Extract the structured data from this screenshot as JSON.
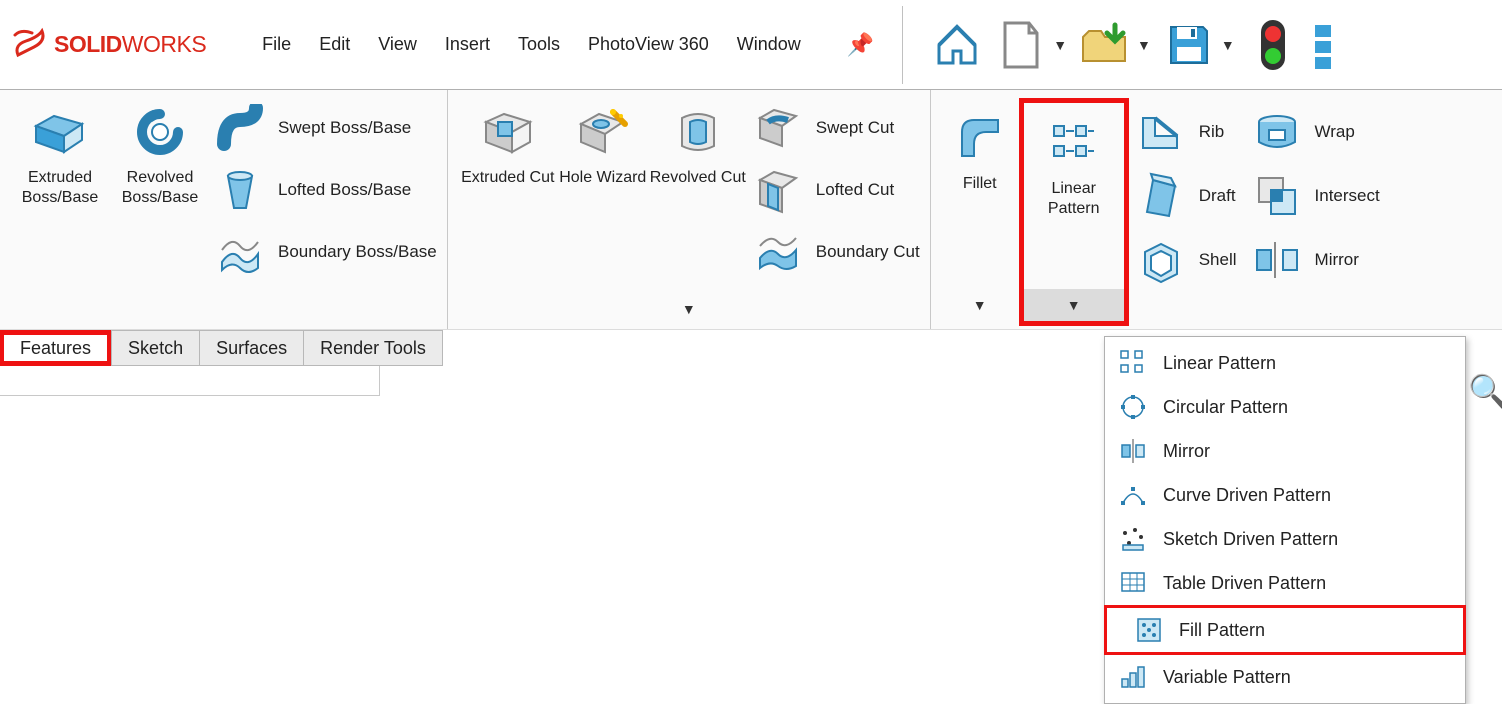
{
  "app": {
    "name_bold": "SOLID",
    "name_thin": "WORKS"
  },
  "menu": {
    "file": "File",
    "edit": "Edit",
    "view": "View",
    "insert": "Insert",
    "tools": "Tools",
    "photoview": "PhotoView 360",
    "window": "Window"
  },
  "ribbon": {
    "extruded_boss": "Extruded Boss/Base",
    "revolved_boss": "Revolved Boss/Base",
    "swept_boss": "Swept Boss/Base",
    "lofted_boss": "Lofted Boss/Base",
    "boundary_boss": "Boundary Boss/Base",
    "extruded_cut": "Extruded Cut",
    "hole_wizard": "Hole Wizard",
    "revolved_cut": "Revolved Cut",
    "swept_cut": "Swept Cut",
    "lofted_cut": "Lofted Cut",
    "boundary_cut": "Boundary Cut",
    "fillet": "Fillet",
    "linear_pattern": "Linear Pattern",
    "rib": "Rib",
    "draft": "Draft",
    "shell": "Shell",
    "wrap": "Wrap",
    "intersect": "Intersect",
    "mirror": "Mirror"
  },
  "tabs": {
    "features": "Features",
    "sketch": "Sketch",
    "surfaces": "Surfaces",
    "render": "Render Tools"
  },
  "dropdown": {
    "linear": "Linear Pattern",
    "circular": "Circular Pattern",
    "mirror": "Mirror",
    "curve": "Curve Driven Pattern",
    "sketch": "Sketch Driven Pattern",
    "table": "Table Driven Pattern",
    "fill": "Fill Pattern",
    "variable": "Variable Pattern"
  }
}
